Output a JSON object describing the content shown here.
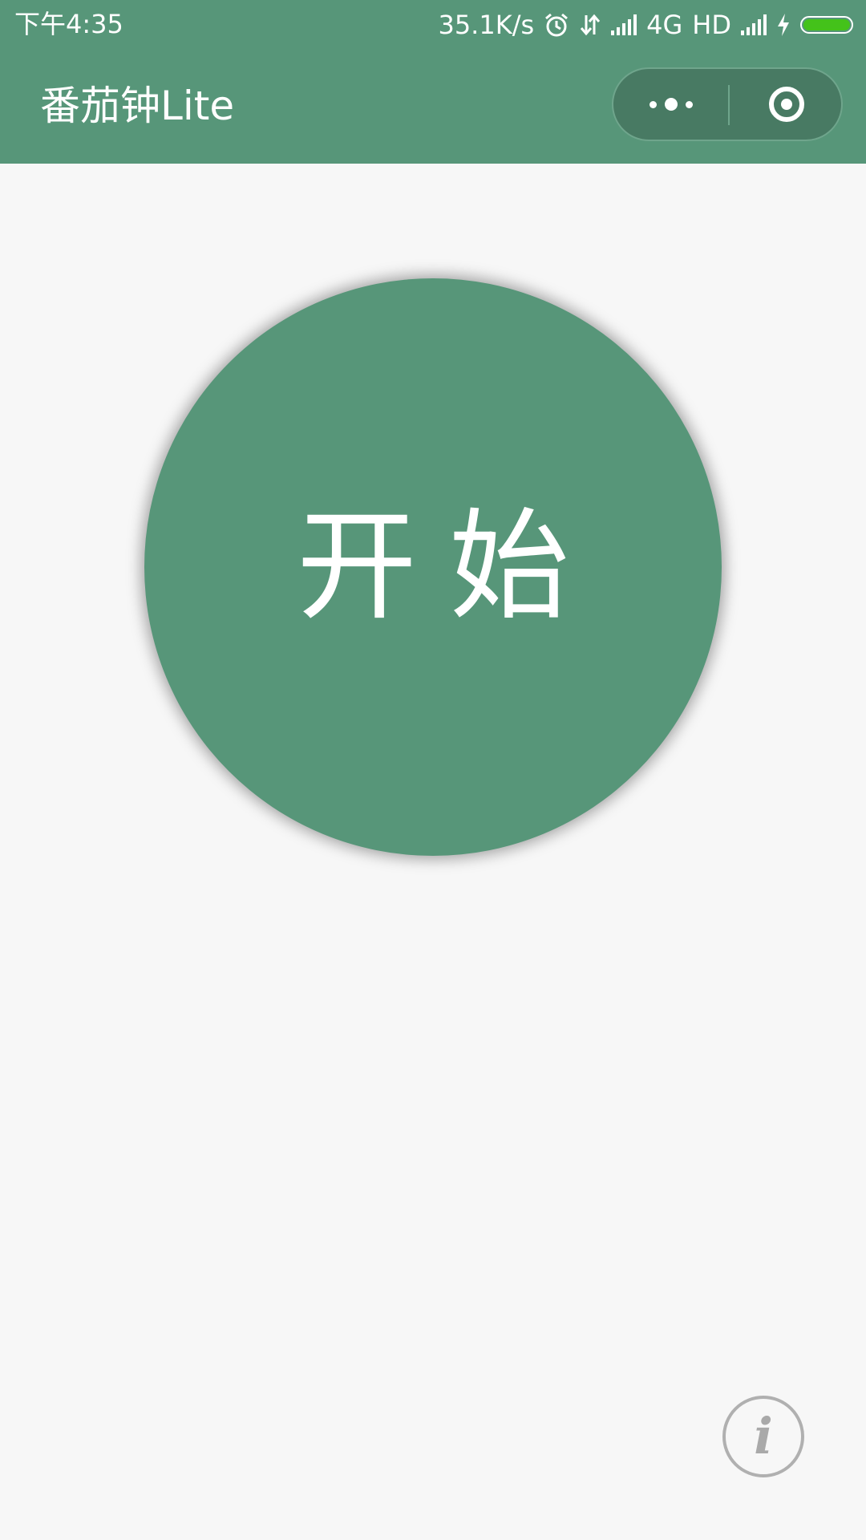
{
  "status_bar": {
    "time": "下午4:35",
    "network_speed": "35.1K/s",
    "network_type": "4G",
    "hd_label": "HD",
    "icons": [
      "alarm-icon",
      "data-transfer-icon",
      "signal-icon",
      "signal-icon",
      "charging-icon",
      "battery-icon"
    ],
    "battery_color": "#44c21a"
  },
  "nav_bar": {
    "title": "番茄钟Lite",
    "background": "#579679",
    "more_icon": "more-dots-icon",
    "close_icon": "target-close-icon"
  },
  "main": {
    "start_label": "开始",
    "button_color": "#579679"
  },
  "info": {
    "glyph": "i",
    "icon": "info-icon"
  }
}
